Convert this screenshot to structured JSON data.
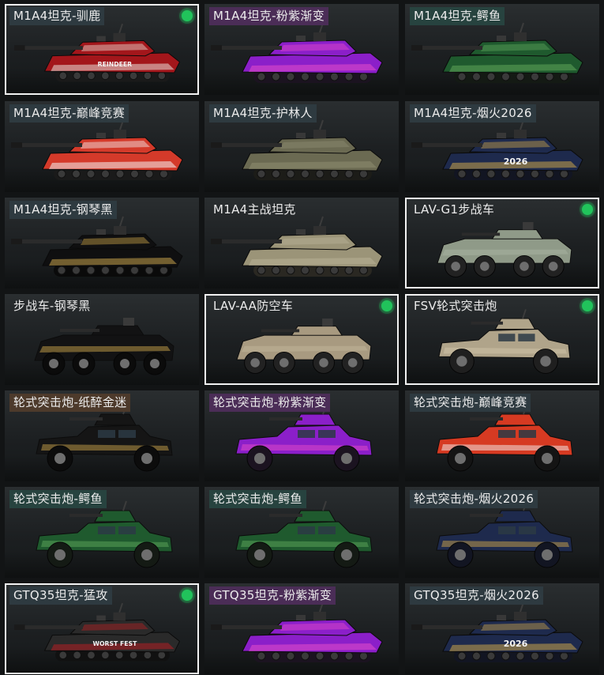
{
  "colors": {
    "equipped_indicator": "#21c35b",
    "selected_border": "#f2f2f2",
    "tile_background": "#1f2325"
  },
  "cards": [
    {
      "label": "M1A4坦克-驯鹿",
      "label_tint": "slate",
      "selected": true,
      "equipped": true,
      "vehicle": "tank",
      "palette": {
        "body": "#a3161b",
        "accent": "#e8e0d8",
        "tracks": "#1a1a1a"
      },
      "decal": "REINDEER"
    },
    {
      "label": "M1A4坦克-粉紫渐变",
      "label_tint": "purple",
      "selected": false,
      "equipped": false,
      "vehicle": "tank",
      "palette": {
        "body": "#8b1fc9",
        "accent": "#e64cc8",
        "tracks": "#1b1320"
      },
      "decal": ""
    },
    {
      "label": "M1A4坦克-鳄鱼",
      "label_tint": "teal",
      "selected": false,
      "equipped": false,
      "vehicle": "tank",
      "palette": {
        "body": "#1f5a2e",
        "accent": "#5ea55a",
        "tracks": "#141a14"
      },
      "decal": ""
    },
    {
      "label": "M1A4坦克-巅峰竞赛",
      "label_tint": "slate",
      "selected": false,
      "equipped": false,
      "vehicle": "tank",
      "palette": {
        "body": "#d43a2a",
        "accent": "#f2f2f2",
        "tracks": "#1a1a1a"
      },
      "decal": ""
    },
    {
      "label": "M1A4坦克-护林人",
      "label_tint": "slate",
      "selected": false,
      "equipped": false,
      "vehicle": "tank",
      "palette": {
        "body": "#6b6a52",
        "accent": "#8e8c70",
        "tracks": "#1c1c18"
      },
      "decal": ""
    },
    {
      "label": "M1A4坦克-烟火2026",
      "label_tint": "slate",
      "selected": false,
      "equipped": false,
      "vehicle": "tank",
      "palette": {
        "body": "#1e2a4d",
        "accent": "#c9a24a",
        "tracks": "#121522"
      },
      "decal": "2026"
    },
    {
      "label": "M1A4坦克-钢琴黑",
      "label_tint": "slate",
      "selected": false,
      "equipped": false,
      "vehicle": "tank",
      "palette": {
        "body": "#0f0f10",
        "accent": "#c7a24a",
        "tracks": "#0a0a0a"
      },
      "decal": ""
    },
    {
      "label": "M1A4主战坦克",
      "label_tint": "dark",
      "selected": false,
      "equipped": false,
      "vehicle": "tank",
      "palette": {
        "body": "#9b9478",
        "accent": "#b8b196",
        "tracks": "#2a2822"
      },
      "decal": ""
    },
    {
      "label": "LAV-G1步战车",
      "label_tint": "dark",
      "selected": true,
      "equipped": true,
      "vehicle": "apc",
      "palette": {
        "body": "#8f9a88",
        "accent": "#a9b3a2",
        "tracks": "#222222"
      },
      "decal": ""
    },
    {
      "label": "步战车-钢琴黑",
      "label_tint": "dark",
      "selected": false,
      "equipped": false,
      "vehicle": "apc",
      "palette": {
        "body": "#121213",
        "accent": "#c7a24a",
        "tracks": "#0b0b0b"
      },
      "decal": ""
    },
    {
      "label": "LAV-AA防空车",
      "label_tint": "dark",
      "selected": true,
      "equipped": true,
      "vehicle": "apc",
      "palette": {
        "body": "#a89a80",
        "accent": "#c2b59a",
        "tracks": "#222222"
      },
      "decal": ""
    },
    {
      "label": "FSV轮式突击炮",
      "label_tint": "dark",
      "selected": true,
      "equipped": true,
      "vehicle": "armored_car",
      "palette": {
        "body": "#b0a48a",
        "accent": "#cfc3a8",
        "tracks": "#1f1f1f"
      },
      "decal": ""
    },
    {
      "label": "轮式突击炮-纸醉金迷",
      "label_tint": "brown",
      "selected": false,
      "equipped": false,
      "vehicle": "armored_car",
      "palette": {
        "body": "#151515",
        "accent": "#c7a24a",
        "tracks": "#0c0c0c"
      },
      "decal": ""
    },
    {
      "label": "轮式突击炮-粉紫渐变",
      "label_tint": "purple",
      "selected": false,
      "equipped": false,
      "vehicle": "armored_car",
      "palette": {
        "body": "#8b1fc9",
        "accent": "#e64cc8",
        "tracks": "#1b1320"
      },
      "decal": ""
    },
    {
      "label": "轮式突击炮-巅峰竞赛",
      "label_tint": "slate",
      "selected": false,
      "equipped": false,
      "vehicle": "armored_car",
      "palette": {
        "body": "#d63a22",
        "accent": "#f2f2f2",
        "tracks": "#141414"
      },
      "decal": ""
    },
    {
      "label": "轮式突击炮-鳄鱼",
      "label_tint": "teal",
      "selected": false,
      "equipped": false,
      "vehicle": "armored_car",
      "palette": {
        "body": "#1f5a2e",
        "accent": "#5ea55a",
        "tracks": "#141a14"
      },
      "decal": ""
    },
    {
      "label": "轮式突击炮-鳄鱼",
      "label_tint": "teal",
      "selected": false,
      "equipped": false,
      "vehicle": "armored_car",
      "palette": {
        "body": "#1f5a2e",
        "accent": "#5ea55a",
        "tracks": "#141a14"
      },
      "decal": ""
    },
    {
      "label": "轮式突击炮-烟火2026",
      "label_tint": "slate",
      "selected": false,
      "equipped": false,
      "vehicle": "armored_car",
      "palette": {
        "body": "#1e2a4d",
        "accent": "#c9a24a",
        "tracks": "#121522"
      },
      "decal": ""
    },
    {
      "label": "GTQ35坦克-猛攻",
      "label_tint": "slate",
      "selected": true,
      "equipped": true,
      "vehicle": "tank",
      "palette": {
        "body": "#2a2a2a",
        "accent": "#b31e22",
        "tracks": "#111111"
      },
      "decal": "WORST FEST"
    },
    {
      "label": "GTQ35坦克-粉紫渐变",
      "label_tint": "purple",
      "selected": false,
      "equipped": false,
      "vehicle": "tank",
      "palette": {
        "body": "#8b1fc9",
        "accent": "#e64cc8",
        "tracks": "#1b1320"
      },
      "decal": ""
    },
    {
      "label": "GTQ35坦克-烟火2026",
      "label_tint": "slate",
      "selected": false,
      "equipped": false,
      "vehicle": "tank",
      "palette": {
        "body": "#1e2a4d",
        "accent": "#c9a24a",
        "tracks": "#121522"
      },
      "decal": "2026"
    }
  ]
}
